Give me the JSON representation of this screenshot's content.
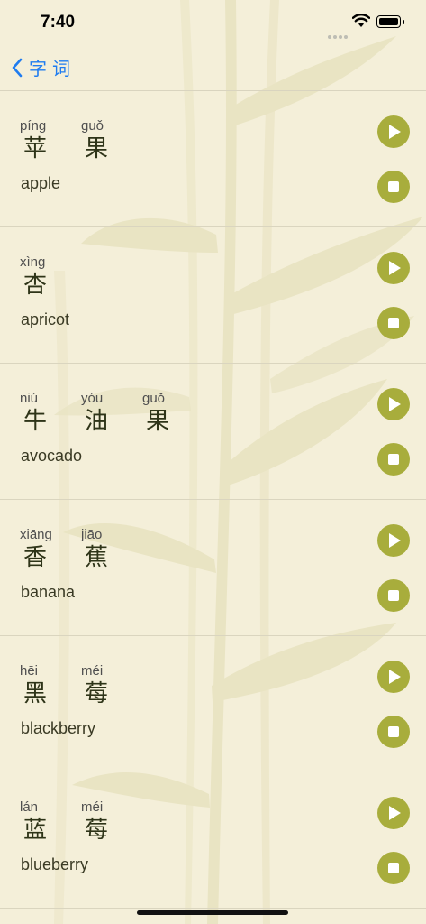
{
  "status": {
    "time": "7:40"
  },
  "nav": {
    "back_label": "字词"
  },
  "colors": {
    "accent": "#a8ad3c",
    "link": "#1f7cf0",
    "background": "#f4efd9"
  },
  "icons": {
    "play": "play-icon",
    "stop": "stop-icon",
    "back": "chevron-left-icon"
  },
  "entries": [
    {
      "chars": [
        {
          "pinyin": "píng",
          "hanzi": "苹"
        },
        {
          "pinyin": "guǒ",
          "hanzi": "果"
        }
      ],
      "english": "apple"
    },
    {
      "chars": [
        {
          "pinyin": "xìng",
          "hanzi": "杏"
        }
      ],
      "english": "apricot"
    },
    {
      "chars": [
        {
          "pinyin": "niú",
          "hanzi": "牛"
        },
        {
          "pinyin": "yóu",
          "hanzi": "油"
        },
        {
          "pinyin": "guǒ",
          "hanzi": "果"
        }
      ],
      "english": "avocado"
    },
    {
      "chars": [
        {
          "pinyin": "xiāng",
          "hanzi": "香"
        },
        {
          "pinyin": "jiāo",
          "hanzi": "蕉"
        }
      ],
      "english": "banana"
    },
    {
      "chars": [
        {
          "pinyin": "hēi",
          "hanzi": "黑"
        },
        {
          "pinyin": "méi",
          "hanzi": "莓"
        }
      ],
      "english": "blackberry"
    },
    {
      "chars": [
        {
          "pinyin": "lán",
          "hanzi": "蓝"
        },
        {
          "pinyin": "méi",
          "hanzi": "莓"
        }
      ],
      "english": "blueberry"
    }
  ]
}
